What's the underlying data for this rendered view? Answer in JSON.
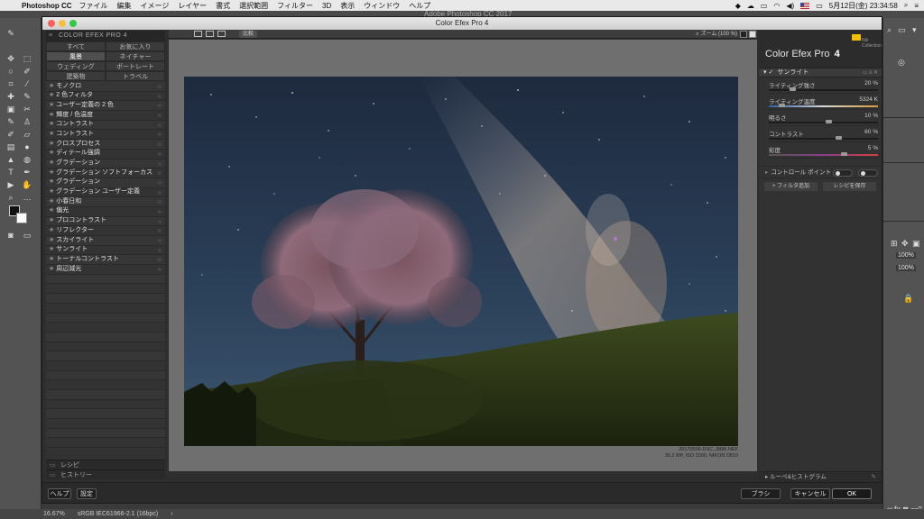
{
  "menubar": {
    "app_name": "Photoshop CC",
    "items": [
      "ファイル",
      "編集",
      "イメージ",
      "レイヤー",
      "書式",
      "選択範囲",
      "フィルター",
      "3D",
      "表示",
      "ウィンドウ",
      "ヘルプ"
    ],
    "datetime": "5月12日(金)  23:34:58"
  },
  "photoshop": {
    "window_title": "Adobe Photoshop CC 2017",
    "status_zoom": "16.67%",
    "status_profile": "sRGB IEC61966-2.1 (16bpc)",
    "right_percent_1": "100%",
    "right_percent_2": "100%"
  },
  "dialog": {
    "title": "Color Efex Pro 4",
    "left_panel": {
      "header": "COLOR EFEX PRO 4",
      "categories": [
        "すべて",
        "お気に入り",
        "風景",
        "ネイチャー",
        "ウェディング",
        "ポートレート",
        "建築物",
        "トラベル"
      ],
      "selected_category": "風景",
      "filters": [
        "モノクロ",
        "2 色フィルタ",
        "ユーザー定義の 2 色",
        "輝度 / 色温度",
        "コントラスト",
        "コントラスト",
        "クロスプロセス",
        "ディテール強調",
        "グラデーション",
        "グラデーション ソフトフォーカス",
        "グラデーション",
        "グラデーション ユーザー定義",
        "小春日和",
        "偏光",
        "プロコントラスト",
        "リフレクター",
        "スカイライト",
        "サンライト",
        "トーナルコントラスト",
        "周辺減光"
      ],
      "bottom_items": [
        "レシピ",
        "ヒストリー"
      ]
    },
    "toolbar": {
      "compare_label": "比較",
      "zoom_label": "ズーム (100 %)"
    },
    "photo": {
      "filename": "20170506-DSC_3886.NEF",
      "info": "36.2 MP, ISO 2000, NIKON D810"
    },
    "right_panel": {
      "title": "Color Efex Pro",
      "title_num": "4",
      "logo_text": "Nik Collection",
      "filter_name": "サンライト",
      "sliders": [
        {
          "label": "ライティング強さ",
          "value": "20 %",
          "position": 0.2
        },
        {
          "label": "ライティング温度",
          "value": "5324 K",
          "position": 0.1
        },
        {
          "label": "明るさ",
          "value": "10 %",
          "position": 0.55
        },
        {
          "label": "コントラスト",
          "value": "60 %",
          "position": 0.65
        },
        {
          "label": "彩度",
          "value": "5 %",
          "position": 0.7
        }
      ],
      "control_points_label": "コントロール ポイント",
      "add_filter_label": "+ フィルタ追加",
      "save_recipe_label": "レシピを保存",
      "loupe_label": "ルーペ&ヒストグラム"
    },
    "bottom": {
      "help": "ヘルプ",
      "settings": "設定",
      "brush": "ブラシ",
      "cancel": "キャンセル",
      "ok": "OK"
    }
  }
}
